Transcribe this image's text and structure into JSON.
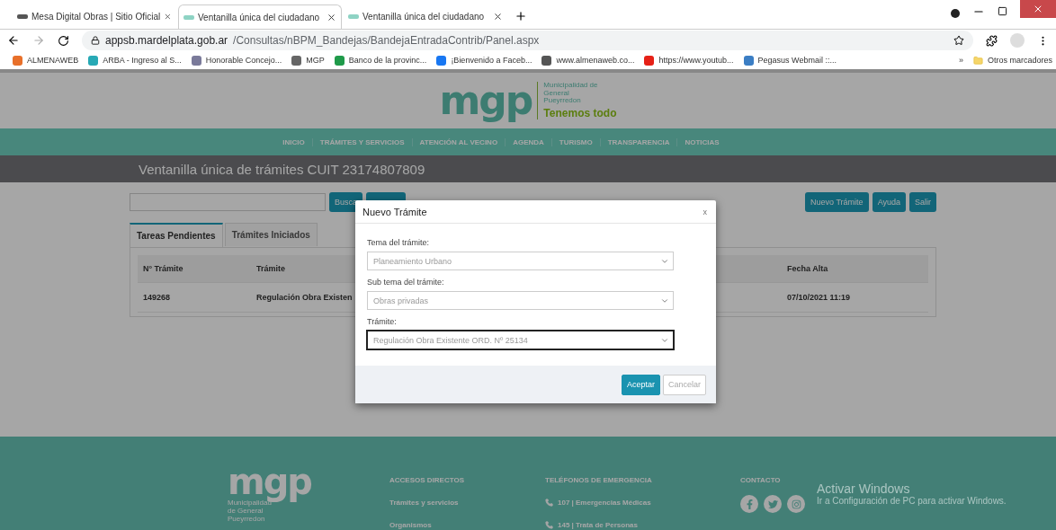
{
  "browser": {
    "tabs": [
      {
        "title": "Mesa Digital Obras | Sitio Oficial",
        "selected": false
      },
      {
        "title": "Ventanilla única del ciudadano",
        "selected": true
      },
      {
        "title": "Ventanilla única del ciudadano",
        "selected": false
      }
    ],
    "url_host": "appsb.mardelplata.gob.ar",
    "url_path": "/Consultas/nBPM_Bandejas/BandejaEntradaContrib/Panel.aspx",
    "bookmarks": [
      {
        "label": "ALMENAWEB",
        "color": "#e8702a"
      },
      {
        "label": "ARBA - Ingreso al S...",
        "color": "#27a9b5"
      },
      {
        "label": "Honorable Concejo...",
        "color": "#7a7a9a"
      },
      {
        "label": "MGP",
        "color": "#666666"
      },
      {
        "label": "Banco de la provinc...",
        "color": "#1f9a4a"
      },
      {
        "label": "¡Bienvenido a Faceb...",
        "color": "#1877f2"
      },
      {
        "label": "www.almenaweb.co...",
        "color": "#555555"
      },
      {
        "label": "https://www.youtub...",
        "color": "#e62117"
      },
      {
        "label": "Pegasus Webmail ::...",
        "color": "#3b7ec4"
      }
    ],
    "more": "»",
    "other_bookmarks": "Otros marcadores"
  },
  "site": {
    "logo": "mgp",
    "logo_sub": "Municipalidad de General Pueyrredon",
    "slogan": "Tenemos todo",
    "nav": [
      "INICIO",
      "TRÁMITES Y SERVICIOS",
      "ATENCIÓN AL VECINO",
      "AGENDA",
      "TURISMO",
      "TRANSPARENCIA",
      "NOTICIAS"
    ],
    "page_title": "Ventanilla única de trámites CUIT 23174807809",
    "search_button": "Busca",
    "actions": [
      "Nuevo Trámite",
      "Ayuda",
      "Salir"
    ],
    "tabs": [
      {
        "label": "Tareas Pendientes",
        "selected": true
      },
      {
        "label": "Trámites Iniciados",
        "selected": false
      }
    ],
    "table": {
      "columns": [
        "N° Trámite",
        "Trámite",
        "Fecha Alta"
      ],
      "rows": [
        [
          "149268",
          "Regulación Obra Existen",
          "07/10/2021 11:19"
        ]
      ]
    },
    "footer": {
      "logo": "mgp",
      "logo_sub": "Municipalidad de General Pueyrredon",
      "columns": [
        {
          "heading": "ACCESOS DIRECTOS",
          "links": [
            {
              "text": "Trámites y servicios",
              "kind": "link"
            },
            {
              "text": "Organismos",
              "kind": "link"
            }
          ]
        },
        {
          "heading": "TELÉFONOS DE EMERGENCIA",
          "links": [
            {
              "text": "107 | Emergencias Médicas",
              "kind": "phone"
            },
            {
              "text": "145 | Trata de Personas",
              "kind": "phone"
            }
          ]
        },
        {
          "heading": "CONTACTO"
        }
      ]
    }
  },
  "dialog": {
    "title": "Nuevo Trámite",
    "close": "x",
    "fields": [
      {
        "label": "Tema del trámite:",
        "value": "Planeamiento Urbano",
        "focused": false
      },
      {
        "label": "Sub tema del trámite:",
        "value": "Obras privadas",
        "focused": false
      },
      {
        "label": "Trámite:",
        "value": "Regulación Obra Existente ORD. Nº 25134",
        "focused": true
      }
    ],
    "buttons": [
      {
        "label": "Aceptar",
        "kind": "primary"
      },
      {
        "label": "Cancelar",
        "kind": "secondary"
      }
    ]
  },
  "os_notice": {
    "title": "Activar Windows",
    "text": "Ir a Configuración de PC para activar Windows."
  }
}
